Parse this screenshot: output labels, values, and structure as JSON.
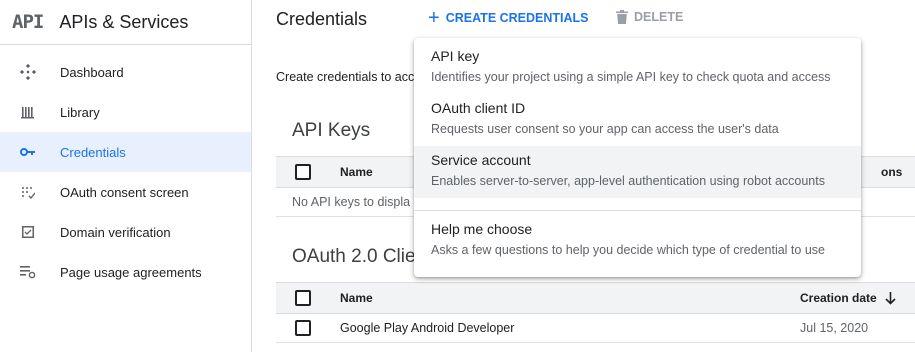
{
  "sidebar": {
    "logo": "API",
    "title": "APIs & Services",
    "items": [
      {
        "label": "Dashboard",
        "icon": "dashboard-icon"
      },
      {
        "label": "Library",
        "icon": "library-icon"
      },
      {
        "label": "Credentials",
        "icon": "key-icon",
        "active": true
      },
      {
        "label": "OAuth consent screen",
        "icon": "consent-icon"
      },
      {
        "label": "Domain verification",
        "icon": "checkbox-icon"
      },
      {
        "label": "Page usage agreements",
        "icon": "settings-list-icon"
      }
    ]
  },
  "header": {
    "title": "Credentials",
    "create_label": "CREATE CREDENTIALS",
    "delete_label": "DELETE"
  },
  "main": {
    "intro": "Create credentials to acc",
    "api_keys": {
      "title": "API Keys",
      "col_name": "Name",
      "col_right": "ons",
      "empty": "No API keys to displa"
    },
    "oauth": {
      "title": "OAuth 2.0 Clie",
      "col_name": "Name",
      "col_date": "Creation date",
      "rows": [
        {
          "name": "Google Play Android Developer",
          "date": "Jul 15, 2020"
        }
      ]
    }
  },
  "menu": {
    "items": [
      {
        "title": "API key",
        "desc": "Identifies your project using a simple API key to check quota and access"
      },
      {
        "title": "OAuth client ID",
        "desc": "Requests user consent so your app can access the user's data"
      },
      {
        "title": "Service account",
        "desc": "Enables server-to-server, app-level authentication using robot accounts",
        "hovered": true
      },
      {
        "title": "Help me choose",
        "desc": "Asks a few questions to help you decide which type of credential to use"
      }
    ]
  },
  "colors": {
    "accent": "#1a73e8",
    "active_bg": "#e8f0fe",
    "muted": "#5f6368"
  }
}
